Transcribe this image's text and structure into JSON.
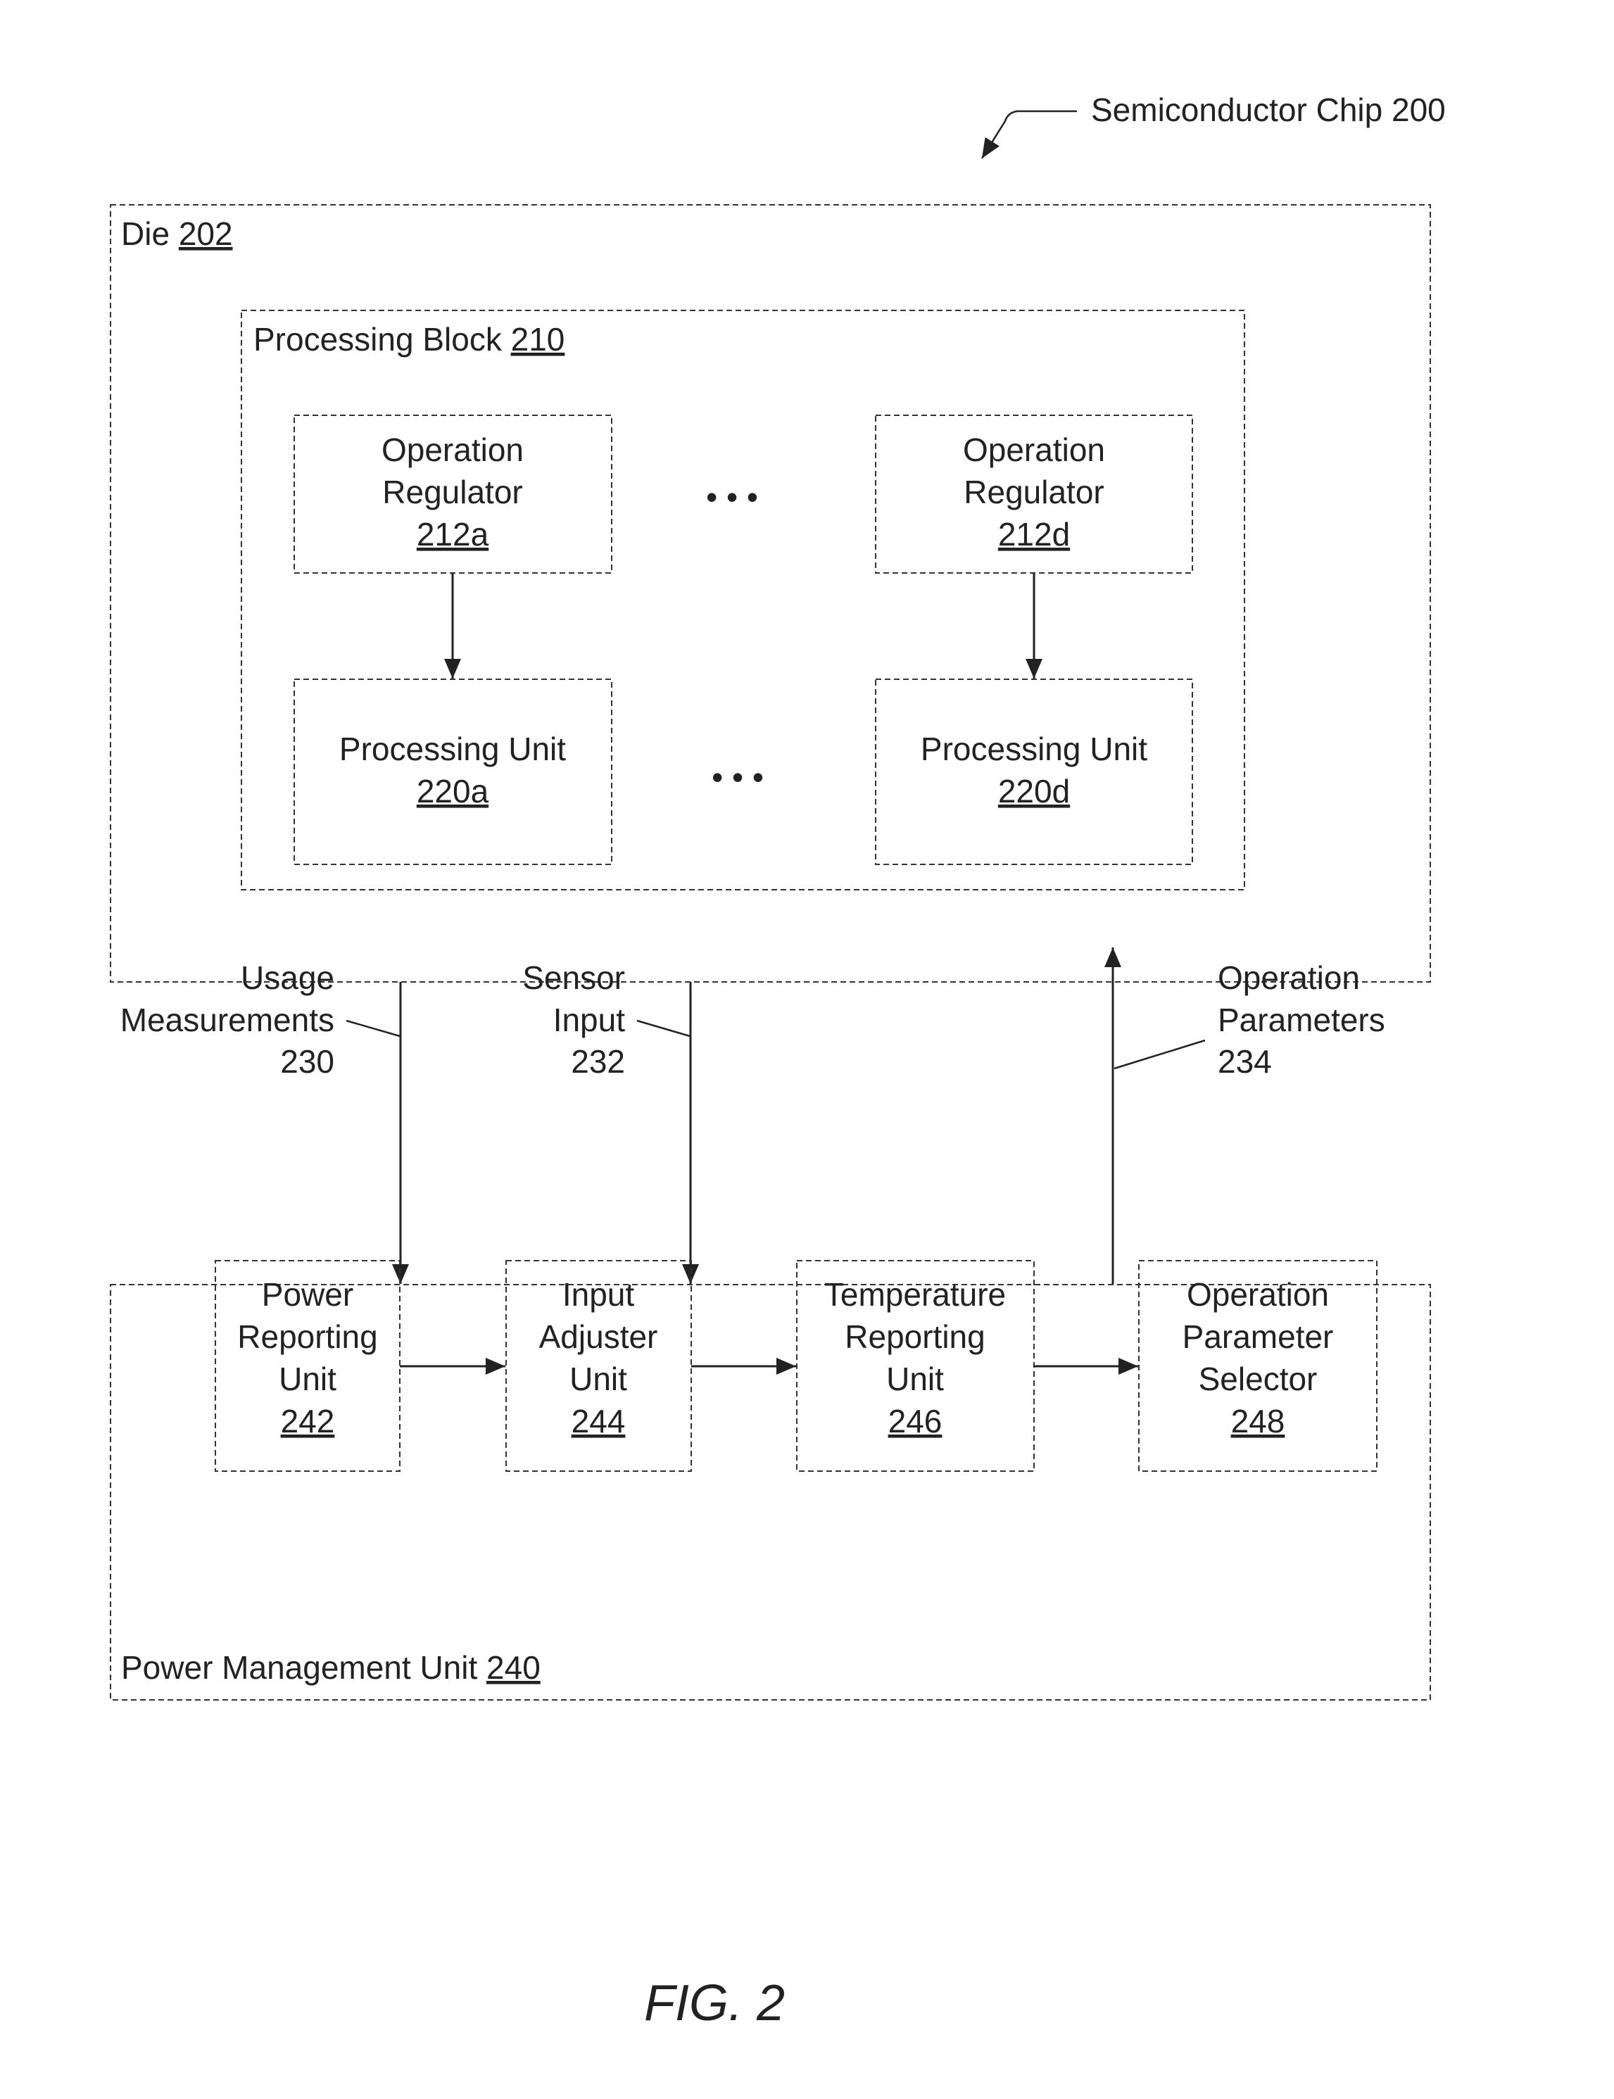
{
  "title": {
    "text": "Semiconductor Chip",
    "ref": "200"
  },
  "die": {
    "label": "Die",
    "ref": "202"
  },
  "processing_block": {
    "label": "Processing Block",
    "ref": "210"
  },
  "regulators": [
    {
      "line1": "Operation",
      "line2": "Regulator",
      "ref": "212a"
    },
    {
      "line1": "Operation",
      "line2": "Regulator",
      "ref": "212d"
    }
  ],
  "units": [
    {
      "label": "Processing Unit",
      "ref": "220a"
    },
    {
      "label": "Processing Unit",
      "ref": "220d"
    }
  ],
  "ellipsis": "• • •",
  "signals": {
    "usage": {
      "line1": "Usage",
      "line2": "Measurements",
      "ref": "230"
    },
    "sensor": {
      "line1": "Sensor",
      "line2": "Input",
      "ref": "232"
    },
    "params": {
      "line1": "Operation",
      "line2": "Parameters",
      "ref": "234"
    }
  },
  "pmu": {
    "label": "Power Management Unit",
    "ref": "240"
  },
  "pmu_blocks": [
    {
      "lines": [
        "Power",
        "Reporting",
        "Unit"
      ],
      "ref": "242"
    },
    {
      "lines": [
        "Input",
        "Adjuster",
        "Unit"
      ],
      "ref": "244"
    },
    {
      "lines": [
        "Temperature",
        "Reporting",
        "Unit"
      ],
      "ref": "246"
    },
    {
      "lines": [
        "Operation",
        "Parameter",
        "Selector"
      ],
      "ref": "248"
    }
  ],
  "figure_label": "FIG. 2"
}
